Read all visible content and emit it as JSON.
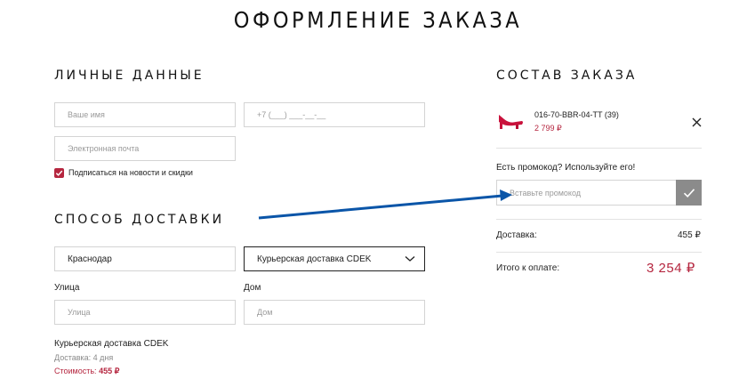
{
  "page": {
    "title": "ОФОРМЛЕНИЕ ЗАКАЗА"
  },
  "personal": {
    "title": "ЛИЧНЫЕ ДАННЫЕ",
    "name_placeholder": "Ваше имя",
    "phone_placeholder": "+7 (___) ___-__-__",
    "email_placeholder": "Электронная почта",
    "subscribe_label": "Подписаться на новости и скидки",
    "subscribe_checked": true
  },
  "delivery": {
    "title": "СПОСОБ ДОСТАВКИ",
    "city_value": "Краснодар",
    "method_selected": "Курьерская доставка CDEK",
    "street_label": "Улица",
    "street_placeholder": "Улица",
    "house_label": "Дом",
    "house_placeholder": "Дом",
    "summary_title": "Курьерская доставка CDEK",
    "summary_days": "Доставка: 4 дня",
    "summary_cost_label": "Стоимость:",
    "summary_cost_value": "455 ₽"
  },
  "order": {
    "title": "СОСТАВ ЗАКАЗА",
    "item_sku": "016-70-BBR-04-TT (39)",
    "item_price": "2 799 ₽",
    "promo_prompt": "Есть промокод? Используйте его!",
    "promo_placeholder": "Вставьте промокод",
    "delivery_label": "Доставка:",
    "delivery_value": "455 ₽",
    "total_label": "Итого к оплате:",
    "total_value": "3 254 ₽"
  },
  "colors": {
    "accent": "#b5263f",
    "annotation_arrow": "#0a55a8",
    "promo_button": "#8b8b8b"
  },
  "icons": [
    "checkmark-icon",
    "chevron-down-icon",
    "close-icon",
    "shoe-thumbnail",
    "annotation-arrow"
  ]
}
